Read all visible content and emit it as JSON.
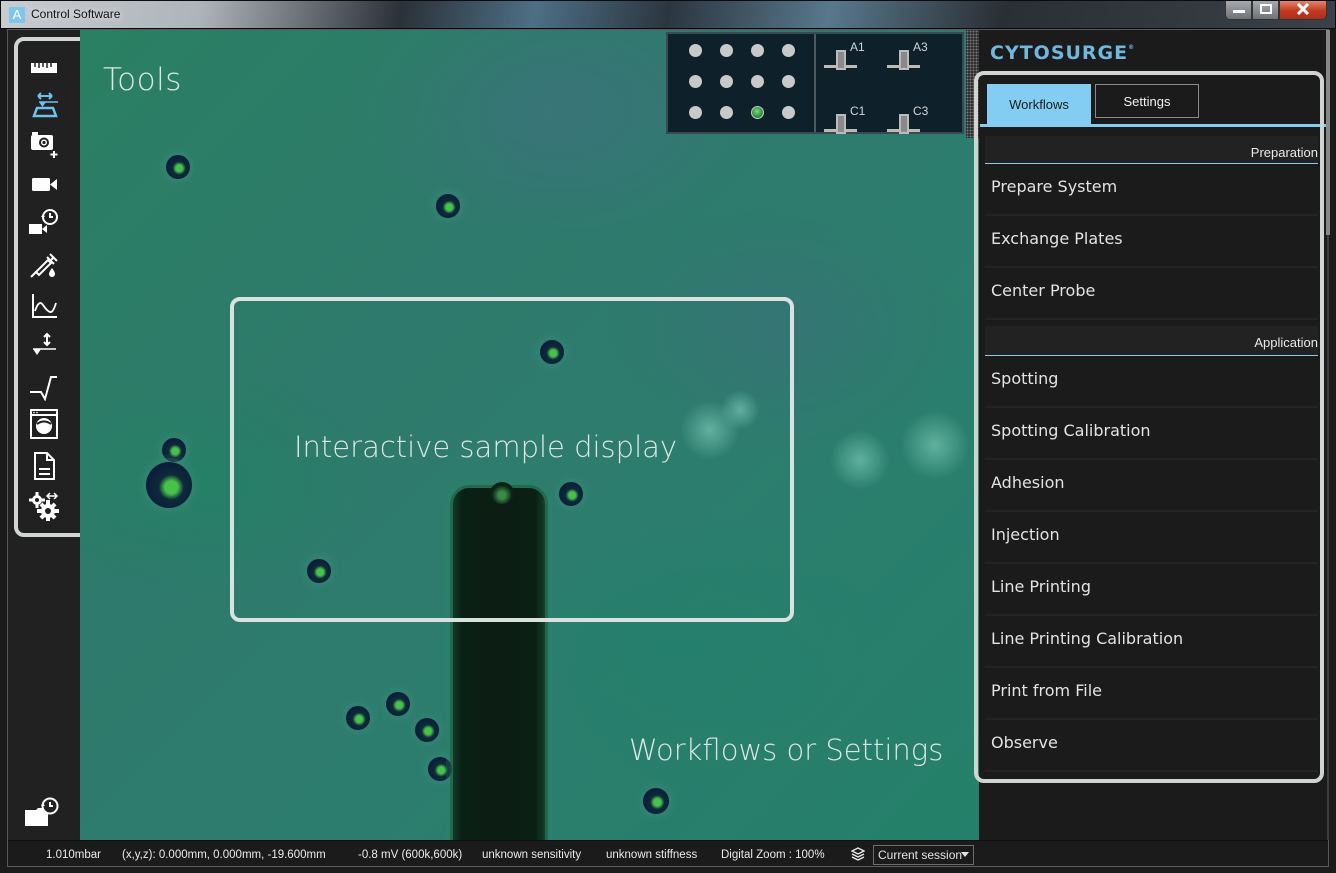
{
  "window": {
    "title": "Control Software",
    "app_icon_glyph": "A",
    "controls": {
      "minimize": "minimize-icon",
      "maximize": "maximize-icon",
      "close": "close-icon"
    }
  },
  "toolbar": {
    "tools": [
      {
        "name": "ruler",
        "icon": "ruler-icon",
        "active": false
      },
      {
        "name": "probe-approach",
        "icon": "probe-approach-icon",
        "active": true
      },
      {
        "name": "snapshot",
        "icon": "camera-add-icon",
        "active": false
      },
      {
        "name": "record-video",
        "icon": "video-camera-icon",
        "active": false
      },
      {
        "name": "timelapse",
        "icon": "video-history-icon",
        "active": false
      },
      {
        "name": "dispense",
        "icon": "syringe-drop-icon",
        "active": false
      },
      {
        "name": "graph",
        "icon": "chart-line-icon",
        "active": false
      },
      {
        "name": "z-move",
        "icon": "z-axis-icon",
        "active": false
      },
      {
        "name": "signal",
        "icon": "signal-step-icon",
        "active": false
      },
      {
        "name": "camera-window",
        "icon": "camera-window-icon",
        "active": false
      },
      {
        "name": "log",
        "icon": "document-icon",
        "active": false
      },
      {
        "name": "settings",
        "icon": "gears-icon",
        "active": false
      }
    ],
    "bottom_button_icon": "folder-history-icon",
    "active_color": "#6fc0ea"
  },
  "viewer": {
    "overlay_labels": {
      "tools": "Tools",
      "sample": "Interactive sample display",
      "workflows": "Workflows or Settings"
    }
  },
  "plate": {
    "rows": 3,
    "cols": 4,
    "active_well": {
      "row": 3,
      "col": 3
    },
    "probe_slots": [
      "A1",
      "A3",
      "C1",
      "C3"
    ]
  },
  "brand": {
    "name": "CYTOSURGE",
    "mark": "®",
    "color": "#6fb9e0"
  },
  "panel": {
    "tabs": [
      {
        "label": "Workflows",
        "active": true
      },
      {
        "label": "Settings",
        "active": false
      }
    ],
    "accent_color": "#83cdf2",
    "sections": [
      {
        "title": "Preparation",
        "items": [
          "Prepare System",
          "Exchange Plates",
          "Center Probe"
        ]
      },
      {
        "title": "Application",
        "items": [
          "Spotting",
          "Spotting Calibration",
          "Adhesion",
          "Injection",
          "Line Printing",
          "Line Printing Calibration",
          "Print from File",
          "Observe"
        ]
      }
    ]
  },
  "status": {
    "pressure": "1.010mbar",
    "position": "(x,y,z): 0.000mm, 0.000mm, -19.600mm",
    "voltage": "-0.8 mV (600k,600k)",
    "sensitivity": "unknown sensitivity",
    "stiffness": "unknown stiffness",
    "zoom": "Digital Zoom :  100%",
    "session": "Current session"
  }
}
